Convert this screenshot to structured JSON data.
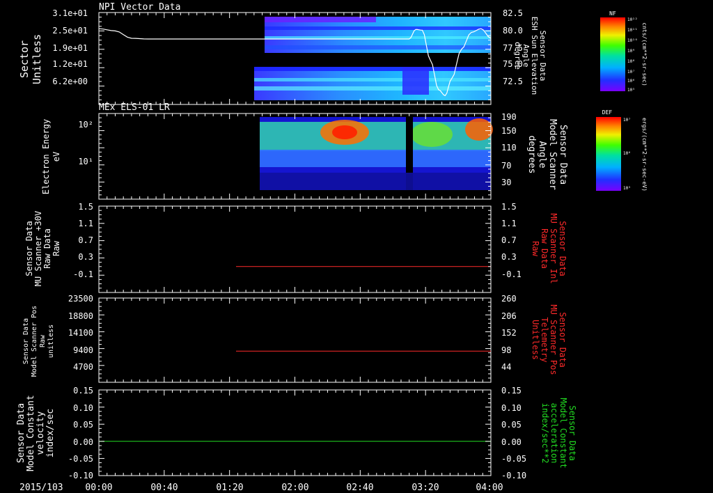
{
  "colors": {
    "background": "#000000",
    "axis": "#ffffff",
    "red_trace": "#ff2a2a",
    "green_trace": "#22dd22"
  },
  "time_axis": {
    "date_label": "2015/103",
    "ticks": [
      "00:00",
      "00:40",
      "01:20",
      "02:00",
      "02:40",
      "03:20",
      "04:00"
    ]
  },
  "chart_data": [
    {
      "type": "heatmap",
      "title": "NPI Vector Data",
      "ylabel": [
        "Sector",
        "Unitless"
      ],
      "yticks_left": [
        "3.1e+01",
        "2.5e+01",
        "1.9e+01",
        "1.2e+01",
        "6.2e+00"
      ],
      "ylabel_right": [
        "Sensor Data",
        "ESH Sun Elevation",
        "Angle",
        "degree"
      ],
      "yticks_right": [
        "82.5",
        "80.0",
        "77.5",
        "75.0",
        "72.5"
      ],
      "ylim_right": [
        70.0,
        82.5
      ],
      "colorbar": {
        "label": "NF",
        "units": "cnts/(cm**2-sr-sec)",
        "ticks": [
          "10¹²",
          "10¹¹",
          "10¹⁰",
          "10⁹",
          "10⁸",
          "10⁷",
          "10⁶",
          "10⁵"
        ]
      },
      "line_series": {
        "name": "ESH Sun Elevation Angle",
        "x_minutes": [
          0,
          10,
          20,
          30,
          40,
          60,
          80,
          100,
          120,
          150,
          180,
          190,
          194,
          198,
          203,
          208,
          212,
          216,
          222,
          228,
          234,
          240
        ],
        "y": [
          80.3,
          80.0,
          79.0,
          78.9,
          78.9,
          78.9,
          78.9,
          78.9,
          78.9,
          78.9,
          78.9,
          78.9,
          80.2,
          80.1,
          76.0,
          72.0,
          71.2,
          73.5,
          77.5,
          79.8,
          80.3,
          79.0
        ]
      }
    },
    {
      "type": "heatmap",
      "title": "MEx ELS-01 LR",
      "ylabel": [
        "Electron Energy",
        "eV"
      ],
      "yticks_left": [
        "10²",
        "10¹"
      ],
      "ylabel_right": [
        "Sensor Data",
        "Model Scanner",
        "Angle",
        "degrees"
      ],
      "yticks_right": [
        "190",
        "150",
        "110",
        "70",
        "30"
      ],
      "ylim_right": [
        10,
        190
      ],
      "colorbar": {
        "label": "DEF",
        "units": "ergs/(cm**2-sr-sec-eV)",
        "ticks": [
          "10⁷",
          "10⁶",
          "10⁵"
        ]
      },
      "line_series": {
        "name": "Model Scanner Angle",
        "x_minutes": [
          0,
          240
        ],
        "y": [
          10,
          10
        ]
      }
    },
    {
      "type": "line",
      "ylabel": [
        "Sensor Data",
        "MU Scanner +30V",
        "Raw Data",
        "Raw"
      ],
      "yticks_left": [
        "1.5",
        "1.1",
        "0.7",
        "0.3",
        "-0.1"
      ],
      "ylabel_right": [
        "Sensor Data",
        "MU Scanner Inl",
        "Raw Data",
        "Raw"
      ],
      "yticks_right": [
        "1.5",
        "1.1",
        "0.7",
        "0.3",
        "-0.1"
      ],
      "ylim": [
        -0.5,
        1.5
      ],
      "series": [
        {
          "name": "MU Scanner Inl",
          "x_minutes": [
            84,
            240
          ],
          "y": [
            0.1,
            0.1
          ]
        }
      ]
    },
    {
      "type": "line",
      "ylabel": [
        "Sensor Data",
        "Model Scanner Pos",
        "Raw",
        "unitless"
      ],
      "yticks_left": [
        "23500",
        "18800",
        "14100",
        "9400",
        "4700"
      ],
      "ylabel_right": [
        "Sensor Data",
        "MU Scanner Pos",
        "Telemetry",
        "Unitless"
      ],
      "yticks_right": [
        "260",
        "206",
        "152",
        "98",
        "44"
      ],
      "ylim_right": [
        -10,
        260
      ],
      "series": [
        {
          "name": "MU Scanner Pos",
          "x_minutes": [
            84,
            240
          ],
          "y": [
            90,
            90
          ]
        }
      ]
    },
    {
      "type": "line",
      "ylabel": [
        "Sensor Data",
        "Model Constant",
        "velocity",
        "index/sec"
      ],
      "yticks_left": [
        "0.15",
        "0.10",
        "0.05",
        "0.00",
        "-0.05",
        "-0.10"
      ],
      "ylabel_right": [
        "Sensor Data",
        "Model Constant",
        "acceleration",
        "index/sec**2"
      ],
      "yticks_right": [
        "0.15",
        "0.10",
        "0.05",
        "0.00",
        "-0.05",
        "-0.10"
      ],
      "ylim": [
        -0.1,
        0.15
      ],
      "series": [
        {
          "name": "Model Constant",
          "x_minutes": [
            0,
            240
          ],
          "y": [
            0,
            0
          ]
        }
      ]
    }
  ]
}
